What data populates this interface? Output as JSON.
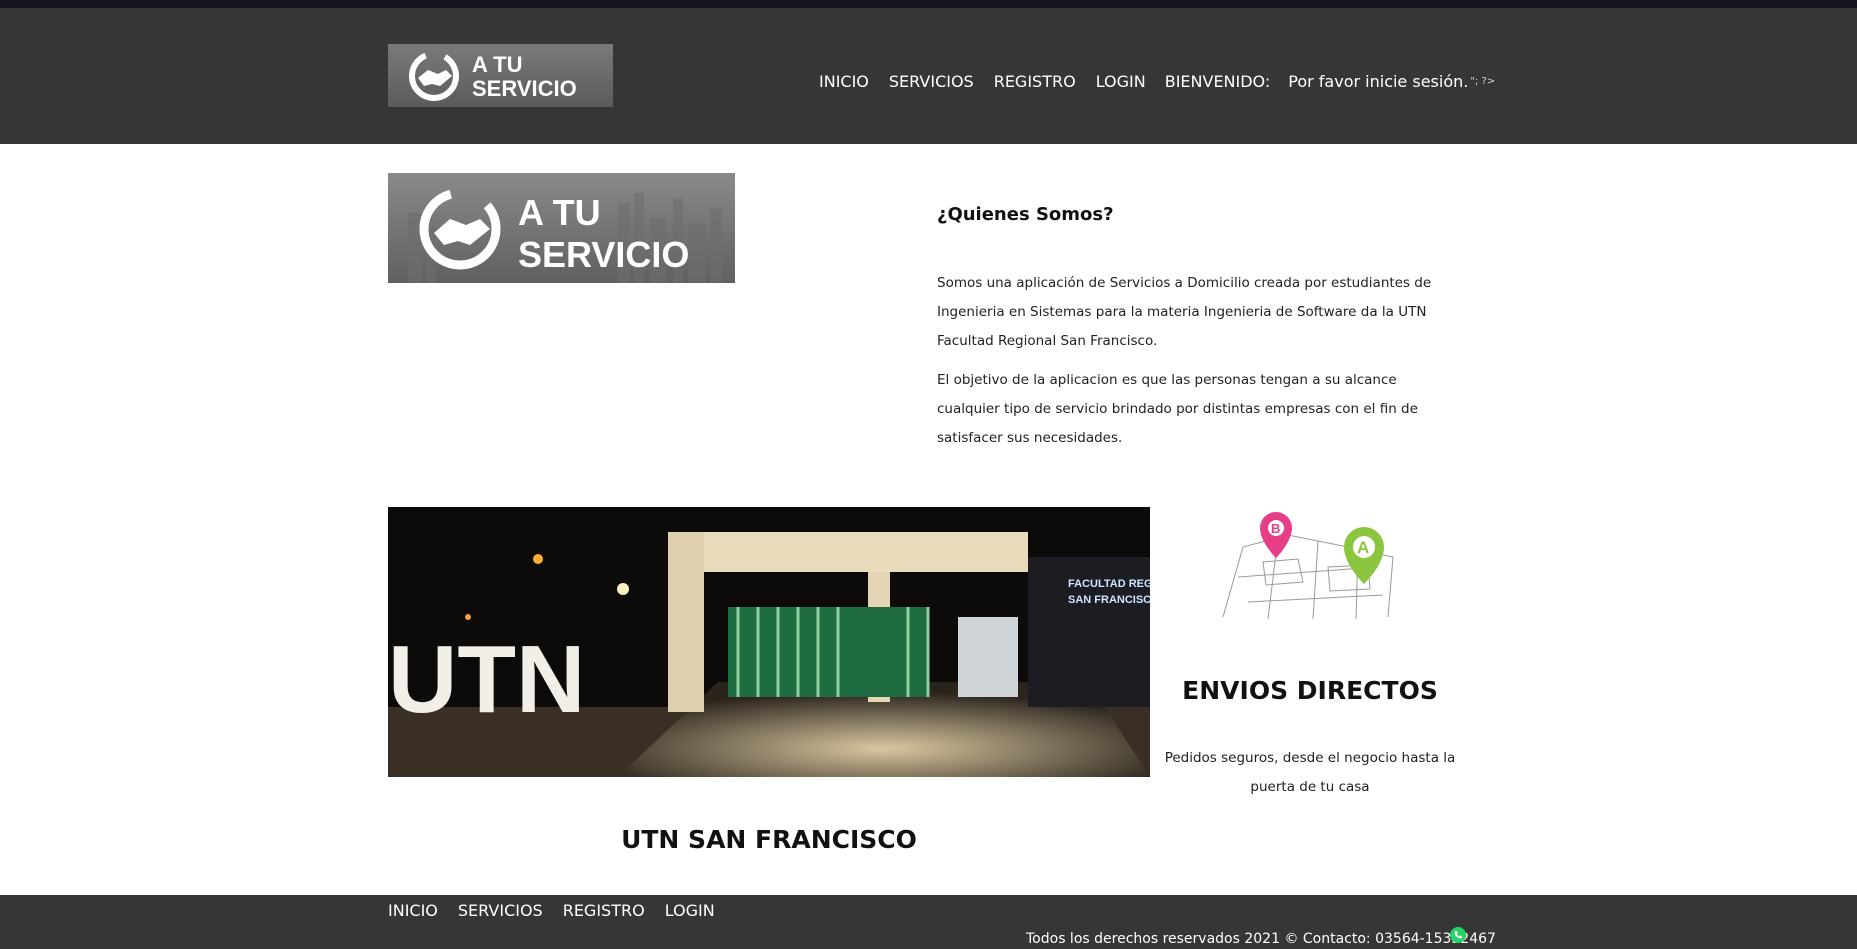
{
  "header": {
    "logo": {
      "line1": "A TU",
      "line2": "SERVICIO"
    },
    "nav": [
      "INICIO",
      "SERVICIOS",
      "REGISTRO",
      "LOGIN"
    ],
    "greeting": "BIENVENIDO:",
    "status": "Por favor inicie sesión.",
    "artifact": "\"; ?>"
  },
  "about": {
    "title": "¿Quienes Somos?",
    "paragraphs": [
      "Somos una aplicación de Servicios a Domicilio creada por estudiantes de Ingenieria en Sistemas para la materia Ingenieria de Software da la UTN Facultad Regional San Francisco.",
      "El objetivo de la aplicacion es que las personas tengan a su alcance cualquier tipo de servicio brindado por distintas empresas con el fin de satisfacer sus necesidades."
    ]
  },
  "photo": {
    "sign": "UTN",
    "building_sign_1": "FACULTAD REGIONAL",
    "building_sign_2": "SAN FRANCISCO"
  },
  "utn_caption": "UTN SAN FRANCISCO",
  "envios": {
    "title": "ENVIOS DIRECTOS",
    "text": "Pedidos seguros, desde el negocio hasta la puerta de tu casa",
    "pin_b": "B",
    "pin_a": "A"
  },
  "footer": {
    "nav": [
      "INICIO",
      "SERVICIOS",
      "REGISTRO",
      "LOGIN"
    ],
    "copyright": "Todos los derechos reservados 2021 © Contacto: 03564-15352467",
    "whatsapp_icon": "whatsapp-icon"
  },
  "colors": {
    "header_bg": "#363636",
    "topbar": "#17141f",
    "pin_b": "#e73e8a",
    "pin_a": "#8cc63f",
    "whatsapp": "#25d366"
  }
}
